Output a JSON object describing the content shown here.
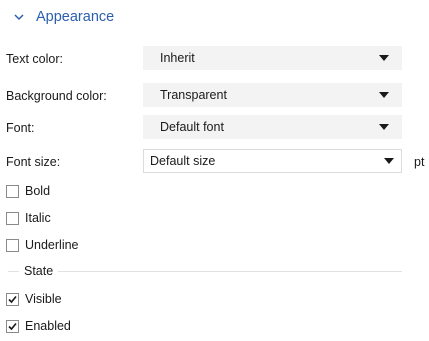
{
  "section": {
    "title": "Appearance",
    "expanded": true,
    "icon": "chevron-down-icon"
  },
  "fields": {
    "text_color": {
      "label": "Text color:",
      "value": "Inherit"
    },
    "background_color": {
      "label": "Background color:",
      "value": "Transparent"
    },
    "font": {
      "label": "Font:",
      "value": "Default font"
    },
    "font_size": {
      "label": "Font size:",
      "value": "Default size",
      "unit": "pt"
    }
  },
  "styles": [
    {
      "label": "Bold",
      "checked": false
    },
    {
      "label": "Italic",
      "checked": false
    },
    {
      "label": "Underline",
      "checked": false
    }
  ],
  "state": {
    "title": "State",
    "items": [
      {
        "label": "Visible",
        "checked": true
      },
      {
        "label": "Enabled",
        "checked": true
      }
    ]
  },
  "colors": {
    "accent": "#2b5fae",
    "combo_bg": "#f3f3f3",
    "divider": "#e2e2e2"
  }
}
